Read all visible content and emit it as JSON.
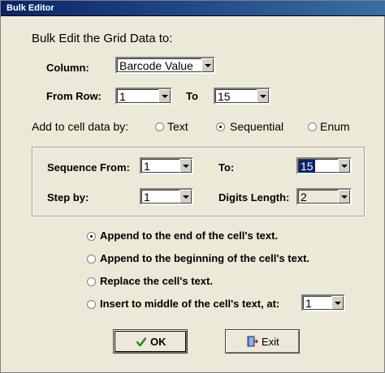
{
  "window": {
    "title": "Bulk Editor"
  },
  "heading": "Bulk Edit the Grid Data to:",
  "column": {
    "label": "Column:",
    "value": "Barcode Value"
  },
  "rows": {
    "from_label": "From Row:",
    "from_value": "1",
    "to_label": "To",
    "to_value": "15"
  },
  "add_by": {
    "label": "Add to cell data by:",
    "options": [
      {
        "label": "Text",
        "selected": false
      },
      {
        "label": "Sequential",
        "selected": true
      },
      {
        "label": "Enum",
        "selected": false
      }
    ]
  },
  "sequence": {
    "from_label": "Sequence From:",
    "from_value": "1",
    "to_label": "To:",
    "to_value": "15",
    "step_label": "Step by:",
    "step_value": "1",
    "digits_label": "Digits Length:",
    "digits_value": "2"
  },
  "position": {
    "options": [
      {
        "label": "Append to the end of the cell's text.",
        "selected": true
      },
      {
        "label": "Append to the beginning of the cell's text.",
        "selected": false
      },
      {
        "label": "Replace the cell's text.",
        "selected": false
      },
      {
        "label": "Insert to middle of the cell's text, at:",
        "selected": false
      }
    ],
    "insert_at_value": "1"
  },
  "buttons": {
    "ok_label": "OK",
    "exit_label": "Exit"
  },
  "icons": {
    "ok": "checkmark-icon",
    "exit": "door-exit-icon"
  }
}
